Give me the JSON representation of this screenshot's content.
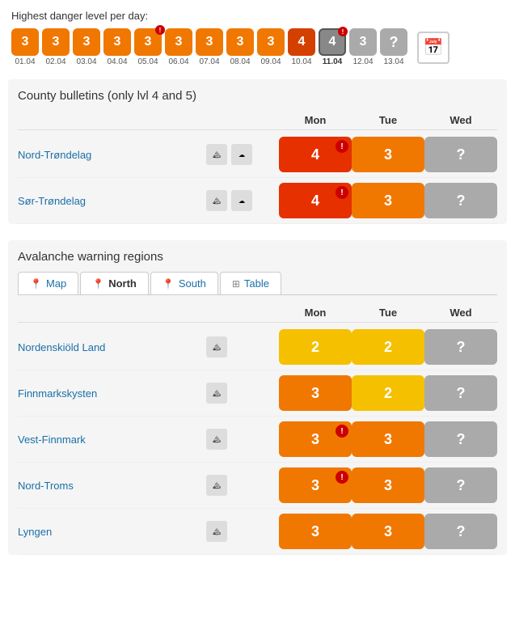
{
  "dangerSection": {
    "label": "Highest danger level per day:",
    "days": [
      {
        "num": "3",
        "date": "01.04",
        "type": "orange",
        "selected": false,
        "excl": false
      },
      {
        "num": "3",
        "date": "02.04",
        "type": "orange",
        "selected": false,
        "excl": false
      },
      {
        "num": "3",
        "date": "03.04",
        "type": "orange",
        "selected": false,
        "excl": false
      },
      {
        "num": "3",
        "date": "04.04",
        "type": "orange",
        "selected": false,
        "excl": false
      },
      {
        "num": "3",
        "date": "05.04",
        "type": "orange",
        "selected": false,
        "excl": true
      },
      {
        "num": "3",
        "date": "06.04",
        "type": "orange",
        "selected": false,
        "excl": false
      },
      {
        "num": "3",
        "date": "07.04",
        "type": "orange",
        "selected": false,
        "excl": false
      },
      {
        "num": "3",
        "date": "08.04",
        "type": "orange",
        "selected": false,
        "excl": false
      },
      {
        "num": "3",
        "date": "09.04",
        "type": "orange",
        "selected": false,
        "excl": false
      },
      {
        "num": "4",
        "date": "10.04",
        "type": "dark-orange",
        "selected": false,
        "excl": false
      },
      {
        "num": "4",
        "date": "11.04",
        "type": "dark-orange",
        "selected": true,
        "excl": true
      },
      {
        "num": "3",
        "date": "12.04",
        "type": "gray",
        "selected": false,
        "excl": false
      },
      {
        "num": "?",
        "date": "13.04",
        "type": "question",
        "selected": false,
        "excl": false
      }
    ]
  },
  "countySection": {
    "title": "County bulletins (only lvl 4 and 5)",
    "headers": {
      "name": "",
      "mon": "Mon",
      "tue": "Tue",
      "wed": "Wed"
    },
    "rows": [
      {
        "name": "Nord-Trøndelag",
        "link": "#nord-trondelag",
        "mon": {
          "val": "4",
          "type": "red",
          "excl": true
        },
        "tue": {
          "val": "3",
          "type": "orange",
          "excl": false
        },
        "wed": {
          "val": "?",
          "type": "gray",
          "excl": false
        }
      },
      {
        "name": "Sør-Trøndelag",
        "link": "#sor-trondelag",
        "mon": {
          "val": "4",
          "type": "red",
          "excl": true
        },
        "tue": {
          "val": "3",
          "type": "orange",
          "excl": false
        },
        "wed": {
          "val": "?",
          "type": "gray",
          "excl": false
        }
      }
    ]
  },
  "avalancheSection": {
    "title": "Avalanche warning regions",
    "tabs": [
      {
        "label": "Map",
        "icon": "📍",
        "active": false
      },
      {
        "label": "North",
        "icon": "📍",
        "active": true
      },
      {
        "label": "South",
        "icon": "📍",
        "active": false
      },
      {
        "label": "Table",
        "icon": "⊞",
        "active": false
      }
    ],
    "headers": {
      "mon": "Mon",
      "tue": "Tue",
      "wed": "Wed"
    },
    "rows": [
      {
        "name": "Nordenskiöld Land",
        "link": "#nordenskiold",
        "mon": {
          "val": "2",
          "type": "yellow",
          "excl": false
        },
        "tue": {
          "val": "2",
          "type": "yellow",
          "excl": false
        },
        "wed": {
          "val": "?",
          "type": "gray",
          "excl": false
        }
      },
      {
        "name": "Finnmarkskysten",
        "link": "#finnmarkskysten",
        "mon": {
          "val": "3",
          "type": "orange",
          "excl": false
        },
        "tue": {
          "val": "2",
          "type": "yellow",
          "excl": false
        },
        "wed": {
          "val": "?",
          "type": "gray",
          "excl": false
        }
      },
      {
        "name": "Vest-Finnmark",
        "link": "#vest-finnmark",
        "mon": {
          "val": "3",
          "type": "orange",
          "excl": true
        },
        "tue": {
          "val": "3",
          "type": "orange",
          "excl": false
        },
        "wed": {
          "val": "?",
          "type": "gray",
          "excl": false
        }
      },
      {
        "name": "Nord-Troms",
        "link": "#nord-troms",
        "mon": {
          "val": "3",
          "type": "orange",
          "excl": true
        },
        "tue": {
          "val": "3",
          "type": "orange",
          "excl": false
        },
        "wed": {
          "val": "?",
          "type": "gray",
          "excl": false
        }
      },
      {
        "name": "Lyngen",
        "link": "#lyngen",
        "mon": {
          "val": "3",
          "type": "orange",
          "excl": false
        },
        "tue": {
          "val": "3",
          "type": "orange",
          "excl": false
        },
        "wed": {
          "val": "?",
          "type": "gray",
          "excl": false
        }
      }
    ]
  }
}
